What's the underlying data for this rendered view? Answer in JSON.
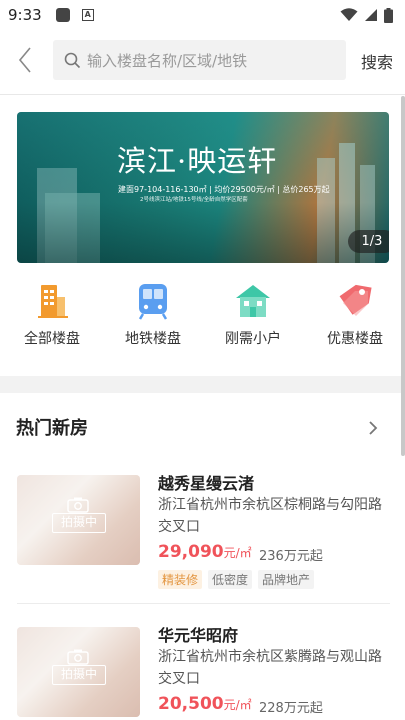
{
  "status_bar": {
    "time": "9:33",
    "icons": [
      "notification-icon",
      "a-icon",
      "wifi-icon",
      "signal-icon",
      "battery-icon"
    ]
  },
  "header": {
    "search_placeholder": "输入楼盘名称/区域/地铁",
    "search_button": "搜索"
  },
  "banner": {
    "title": "滨江·映运轩",
    "specs": "建面97-104-116-130㎡ | 均价29500元/㎡ | 总价265万起",
    "subtitle": "2号线滨江站/地铁15号线/全龄自然学区配套",
    "pager": "1/3"
  },
  "categories": [
    {
      "label": "全部楼盘",
      "icon": "building-icon",
      "color": "#f29a2e"
    },
    {
      "label": "地铁楼盘",
      "icon": "subway-icon",
      "color": "#5a9ef0"
    },
    {
      "label": "刚需小户",
      "icon": "house-icon",
      "color": "#3ec7a7"
    },
    {
      "label": "优惠楼盘",
      "icon": "discount-tag-icon",
      "color": "#f06a6e"
    }
  ],
  "hot_section": {
    "title": "热门新房"
  },
  "listings": [
    {
      "name": "越秀星缦云渚",
      "address": "浙江省杭州市余杭区棕桐路与勾阳路交叉口",
      "price": "29,090",
      "price_unit": "元/㎡",
      "total": "236万元起",
      "thumb_text": "拍摄中",
      "tags": [
        "精装修",
        "低密度",
        "品牌地产"
      ]
    },
    {
      "name": "华元华昭府",
      "address": "浙江省杭州市余杭区紫腾路与观山路交叉口",
      "price": "20,500",
      "price_unit": "元/㎡",
      "total": "228万元起",
      "thumb_text": "拍摄中",
      "tags": []
    }
  ],
  "colors": {
    "accent_price": "#f0535a",
    "tag_highlight": "#e3953f"
  }
}
